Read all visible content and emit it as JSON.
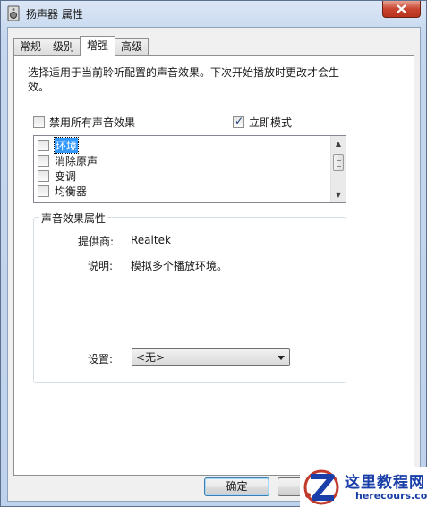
{
  "window": {
    "title": "扬声器 属性"
  },
  "tabs": [
    {
      "label": "常规"
    },
    {
      "label": "级别"
    },
    {
      "label": "增强"
    },
    {
      "label": "高级"
    }
  ],
  "enhance": {
    "description": "选择适用于当前聆听配置的声音效果。下次开始播放时更改才会生效。",
    "disable_all": {
      "label": "禁用所有声音效果",
      "checked": false
    },
    "immediate_mode": {
      "label": "立即模式",
      "checked": true
    },
    "effects": [
      {
        "label": "环境",
        "checked": false,
        "selected": true
      },
      {
        "label": "消除原声",
        "checked": false
      },
      {
        "label": "变调",
        "checked": false
      },
      {
        "label": "均衡器",
        "checked": false
      }
    ],
    "properties": {
      "group_title": "声音效果属性",
      "provider_label": "提供商:",
      "provider_value": "Realtek",
      "description_label": "说明:",
      "description_value": "模拟多个播放环境。",
      "settings_label": "设置:",
      "settings_value": "<无>"
    }
  },
  "buttons": {
    "ok": "确定"
  },
  "watermark": {
    "title": "这里教程网",
    "url": "herecours.com"
  }
}
